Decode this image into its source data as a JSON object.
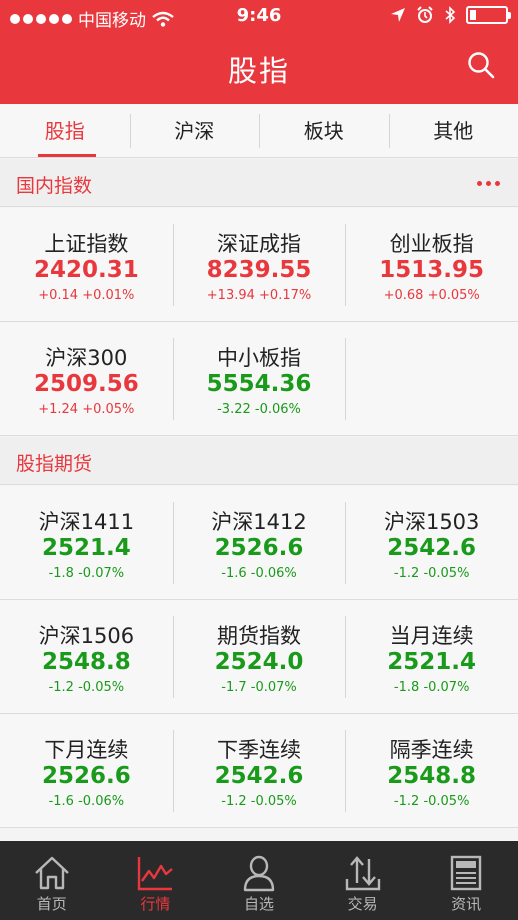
{
  "status_bar": {
    "carrier": "中国移动",
    "time": "9:46"
  },
  "header": {
    "title": "股指"
  },
  "tabs": [
    {
      "label": "股指",
      "active": true
    },
    {
      "label": "沪深",
      "active": false
    },
    {
      "label": "板块",
      "active": false
    },
    {
      "label": "其他",
      "active": false
    }
  ],
  "domestic": {
    "label": "国内指数",
    "rows": [
      [
        {
          "name": "上证指数",
          "value": "2420.31",
          "change": "+0.14",
          "pct": "+0.01%",
          "dir": "up"
        },
        {
          "name": "深证成指",
          "value": "8239.55",
          "change": "+13.94",
          "pct": "+0.17%",
          "dir": "up"
        },
        {
          "name": "创业板指",
          "value": "1513.95",
          "change": "+0.68",
          "pct": "+0.05%",
          "dir": "up"
        }
      ],
      [
        {
          "name": "沪深300",
          "value": "2509.56",
          "change": "+1.24",
          "pct": "+0.05%",
          "dir": "up"
        },
        {
          "name": "中小板指",
          "value": "5554.36",
          "change": "-3.22",
          "pct": "-0.06%",
          "dir": "down"
        }
      ]
    ]
  },
  "futures": {
    "label": "股指期货",
    "rows": [
      [
        {
          "name": "沪深1411",
          "value": "2521.4",
          "change": "-1.8",
          "pct": "-0.07%",
          "dir": "down"
        },
        {
          "name": "沪深1412",
          "value": "2526.6",
          "change": "-1.6",
          "pct": "-0.06%",
          "dir": "down"
        },
        {
          "name": "沪深1503",
          "value": "2542.6",
          "change": "-1.2",
          "pct": "-0.05%",
          "dir": "down"
        }
      ],
      [
        {
          "name": "沪深1506",
          "value": "2548.8",
          "change": "-1.2",
          "pct": "-0.05%",
          "dir": "down"
        },
        {
          "name": "期货指数",
          "value": "2524.0",
          "change": "-1.7",
          "pct": "-0.07%",
          "dir": "down"
        },
        {
          "name": "当月连续",
          "value": "2521.4",
          "change": "-1.8",
          "pct": "-0.07%",
          "dir": "down"
        }
      ],
      [
        {
          "name": "下月连续",
          "value": "2526.6",
          "change": "-1.6",
          "pct": "-0.06%",
          "dir": "down"
        },
        {
          "name": "下季连续",
          "value": "2542.6",
          "change": "-1.2",
          "pct": "-0.05%",
          "dir": "down"
        },
        {
          "name": "隔季连续",
          "value": "2548.8",
          "change": "-1.2",
          "pct": "-0.05%",
          "dir": "down"
        }
      ]
    ]
  },
  "tabbar": [
    {
      "label": "首页",
      "icon": "home-icon",
      "active": false
    },
    {
      "label": "行情",
      "icon": "market-chart-icon",
      "active": true
    },
    {
      "label": "自选",
      "icon": "user-icon",
      "active": false
    },
    {
      "label": "交易",
      "icon": "transfer-arrows-icon",
      "active": false
    },
    {
      "label": "资讯",
      "icon": "news-icon",
      "active": false
    }
  ],
  "colors": {
    "accent": "#e8383d",
    "up": "#e8383d",
    "down": "#1a9a1a",
    "tabbar_bg": "#2a2a2a"
  }
}
